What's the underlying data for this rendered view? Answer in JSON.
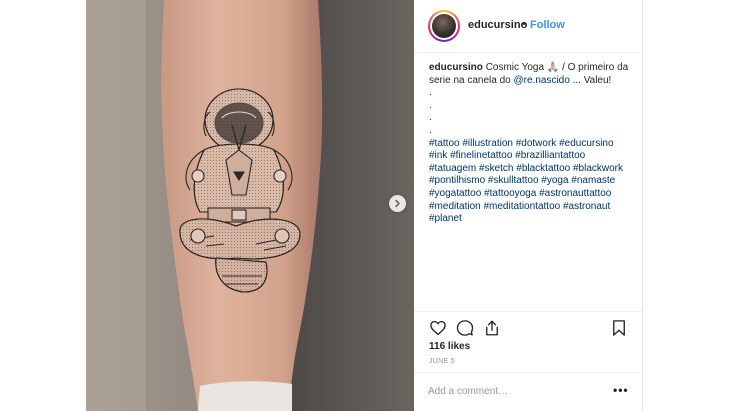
{
  "post": {
    "username": "educursino",
    "separator": "•",
    "follow_label": "Follow",
    "caption_user": "educursino",
    "caption_text_1": "Cosmic Yoga 🙏🏼 / O primeiro da serie na canela do",
    "caption_mention": "@re.nascido",
    "caption_text_2": "... Valeu!",
    "caption_dots": [
      ".",
      ".",
      ".",
      "."
    ],
    "hashtags": "#tattoo #illustration #dotwork #educursino #ink #finelinetattoo #brazilliantattoo #tatuagem #sketch #blacktattoo #blackwork #pontilhismo #skulltattoo #yoga #namaste #yogatattoo #tattooyoga #astronauttattoo #meditation #meditationtattoo #astronaut #planet",
    "likes": "116 likes",
    "date": "JUNE 5",
    "comment_placeholder": "Add a comment…",
    "more_label": "•••"
  },
  "icons": {
    "like": "heart-icon",
    "comment": "comment-icon",
    "share": "share-icon",
    "save": "bookmark-icon",
    "next": "chevron-right-icon"
  },
  "colors": {
    "link": "#003569",
    "follow": "#3897f0",
    "text": "#262626",
    "muted": "#999999"
  }
}
